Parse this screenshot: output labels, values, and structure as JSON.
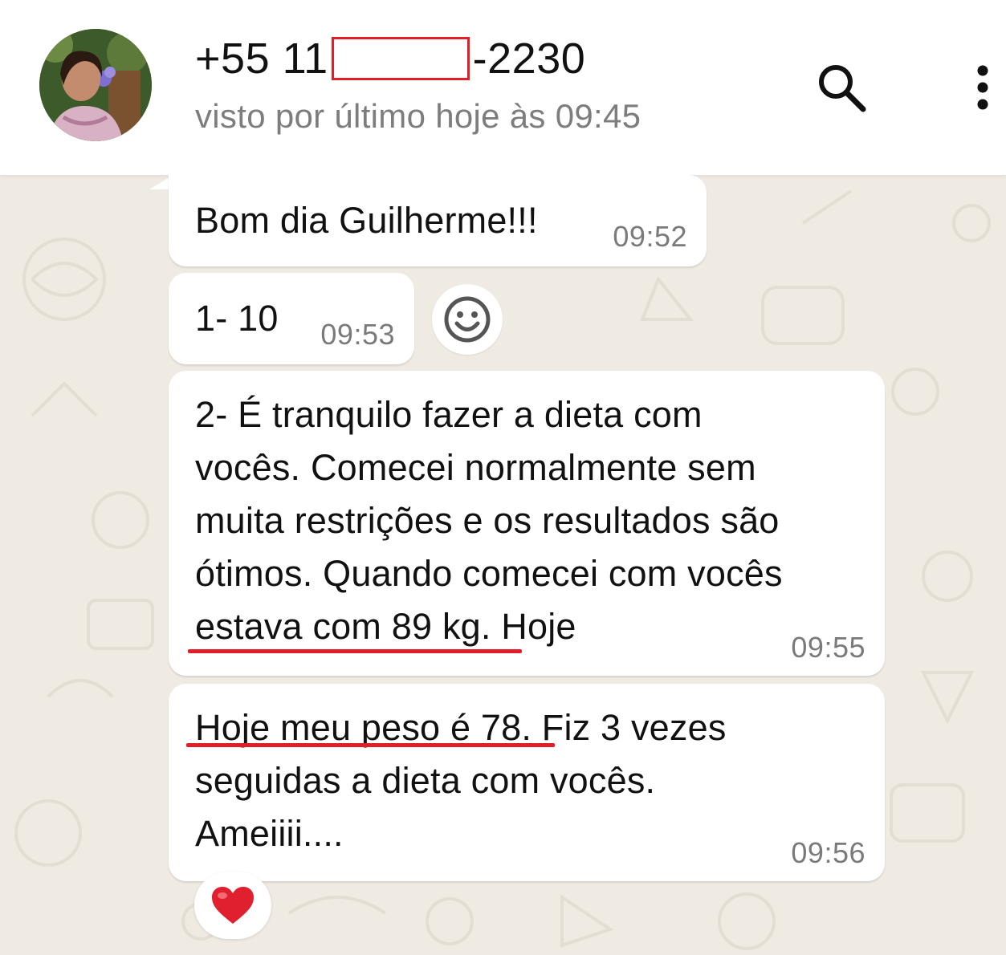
{
  "header": {
    "phone_prefix": "+55 11",
    "phone_suffix": "-2230",
    "status": "visto por último hoje às 09:45",
    "icons": [
      "search-icon",
      "more-options-icon"
    ],
    "colors": {
      "redaction": "#e21d2a",
      "background": "#efeae2",
      "bubble": "#ffffff"
    }
  },
  "messages": [
    {
      "text": "Bom dia Guilherme!!!",
      "time": "09:52"
    },
    {
      "text": "1- 10",
      "time": "09:53"
    },
    {
      "lines": [
        "2- É tranquilo fazer a dieta com",
        "vocês. Comecei normalmente sem",
        "muita restrições e os resultados são",
        "ótimos. Quando comecei com vocês",
        "estava com 89 kg. Hoje"
      ],
      "time": "09:55"
    },
    {
      "lines": [
        "Hoje meu peso é 78. Fiz 3 vezes",
        "seguidas a dieta com vocês.",
        "Ameiiii...."
      ],
      "time": "09:56",
      "reaction": "❤️"
    }
  ]
}
